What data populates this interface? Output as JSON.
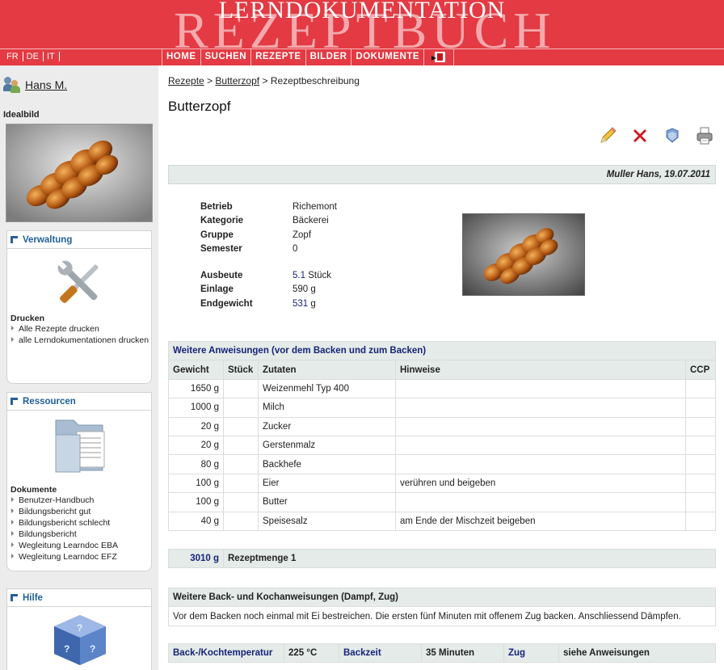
{
  "header": {
    "title_top": "LERNDOKUMENTATION",
    "title_big": "REZEPTBUCH",
    "languages": [
      "FR",
      "DE",
      "IT"
    ],
    "menu": [
      "HOME",
      "SUCHEN",
      "REZEPTE",
      "BILDER",
      "DOKUMENTE"
    ],
    "colors": {
      "header_red": "#e33a43",
      "accent_blue": "#17237a"
    }
  },
  "sidebar": {
    "user_name": "Hans M.",
    "ideal_label": "Idealbild",
    "verwaltung": {
      "title": "Verwaltung",
      "section": "Drucken",
      "links": [
        "Alle Rezepte drucken",
        "alle Lerndokumentationen drucken"
      ]
    },
    "ressourcen": {
      "title": "Ressourcen",
      "section": "Dokumente",
      "links": [
        "Benutzer-Handbuch",
        "Bildungsbericht gut",
        "Bildungsbericht schlecht",
        "Bildungsbericht",
        "Wegleitung Learndoc EBA",
        "Wegleitung Learndoc EFZ"
      ]
    },
    "hilfe": {
      "title": "Hilfe"
    }
  },
  "main": {
    "breadcrumb": [
      "Rezepte",
      "Butterzopf",
      "Rezeptbeschreibung"
    ],
    "breadcrumb_sep": ">",
    "title": "Butterzopf",
    "author_line": "Muller Hans, 19.07.2011",
    "props": {
      "betrieb_label": "Betrieb",
      "betrieb": "Richemont",
      "kategorie_label": "Kategorie",
      "kategorie": "Bäckerei",
      "gruppe_label": "Gruppe",
      "gruppe": "Zopf",
      "semester_label": "Semester",
      "semester": "0",
      "ausbeute_label": "Ausbeute",
      "ausbeute_num": "5.1",
      "ausbeute_unit": "Stück",
      "einlage_label": "Einlage",
      "einlage": "590 g",
      "endgewicht_label": "Endgewicht",
      "endgewicht_num": "531",
      "endgewicht_unit": "g"
    },
    "ingredients": {
      "caption": "Weitere Anweisungen (vor dem Backen und zum Backen)",
      "headers": [
        "Gewicht",
        "Stück",
        "Zutaten",
        "Hinweise",
        "CCP"
      ],
      "rows": [
        [
          "1650 g",
          "",
          "Weizenmehl Typ 400",
          "",
          ""
        ],
        [
          "1000 g",
          "",
          "Milch",
          "",
          ""
        ],
        [
          "20 g",
          "",
          "Zucker",
          "",
          ""
        ],
        [
          "20 g",
          "",
          "Gerstenmalz",
          "",
          ""
        ],
        [
          "80 g",
          "",
          "Backhefe",
          "",
          ""
        ],
        [
          "100 g",
          "",
          "Eier",
          "verühren und beigeben",
          ""
        ],
        [
          "100 g",
          "",
          "Butter",
          "",
          ""
        ],
        [
          "40 g",
          "",
          "Speisesalz",
          "am Ende der Mischzeit beigeben",
          ""
        ]
      ]
    },
    "sum": {
      "amount": "3010 g",
      "label": "Rezeptmenge 1"
    },
    "back": {
      "caption": "Weitere Back- und Kochanweisungen (Dampf, Zug)",
      "text": "Vor dem Backen noch einmal mit Ei bestreichen. Die ersten fünf Minuten mit offenem Zug backen. Anschliessend Dämpfen."
    },
    "bake": {
      "temp_label": "Back-/Kochtemperatur",
      "temp": "225 °C",
      "time_label": "Backzeit",
      "time": "35 Minuten",
      "zug_label": "Zug",
      "zug": "siehe Anweisungen"
    },
    "action_icons": [
      "pencil-icon",
      "delete-x-icon",
      "copy-icon",
      "print-icon"
    ]
  }
}
